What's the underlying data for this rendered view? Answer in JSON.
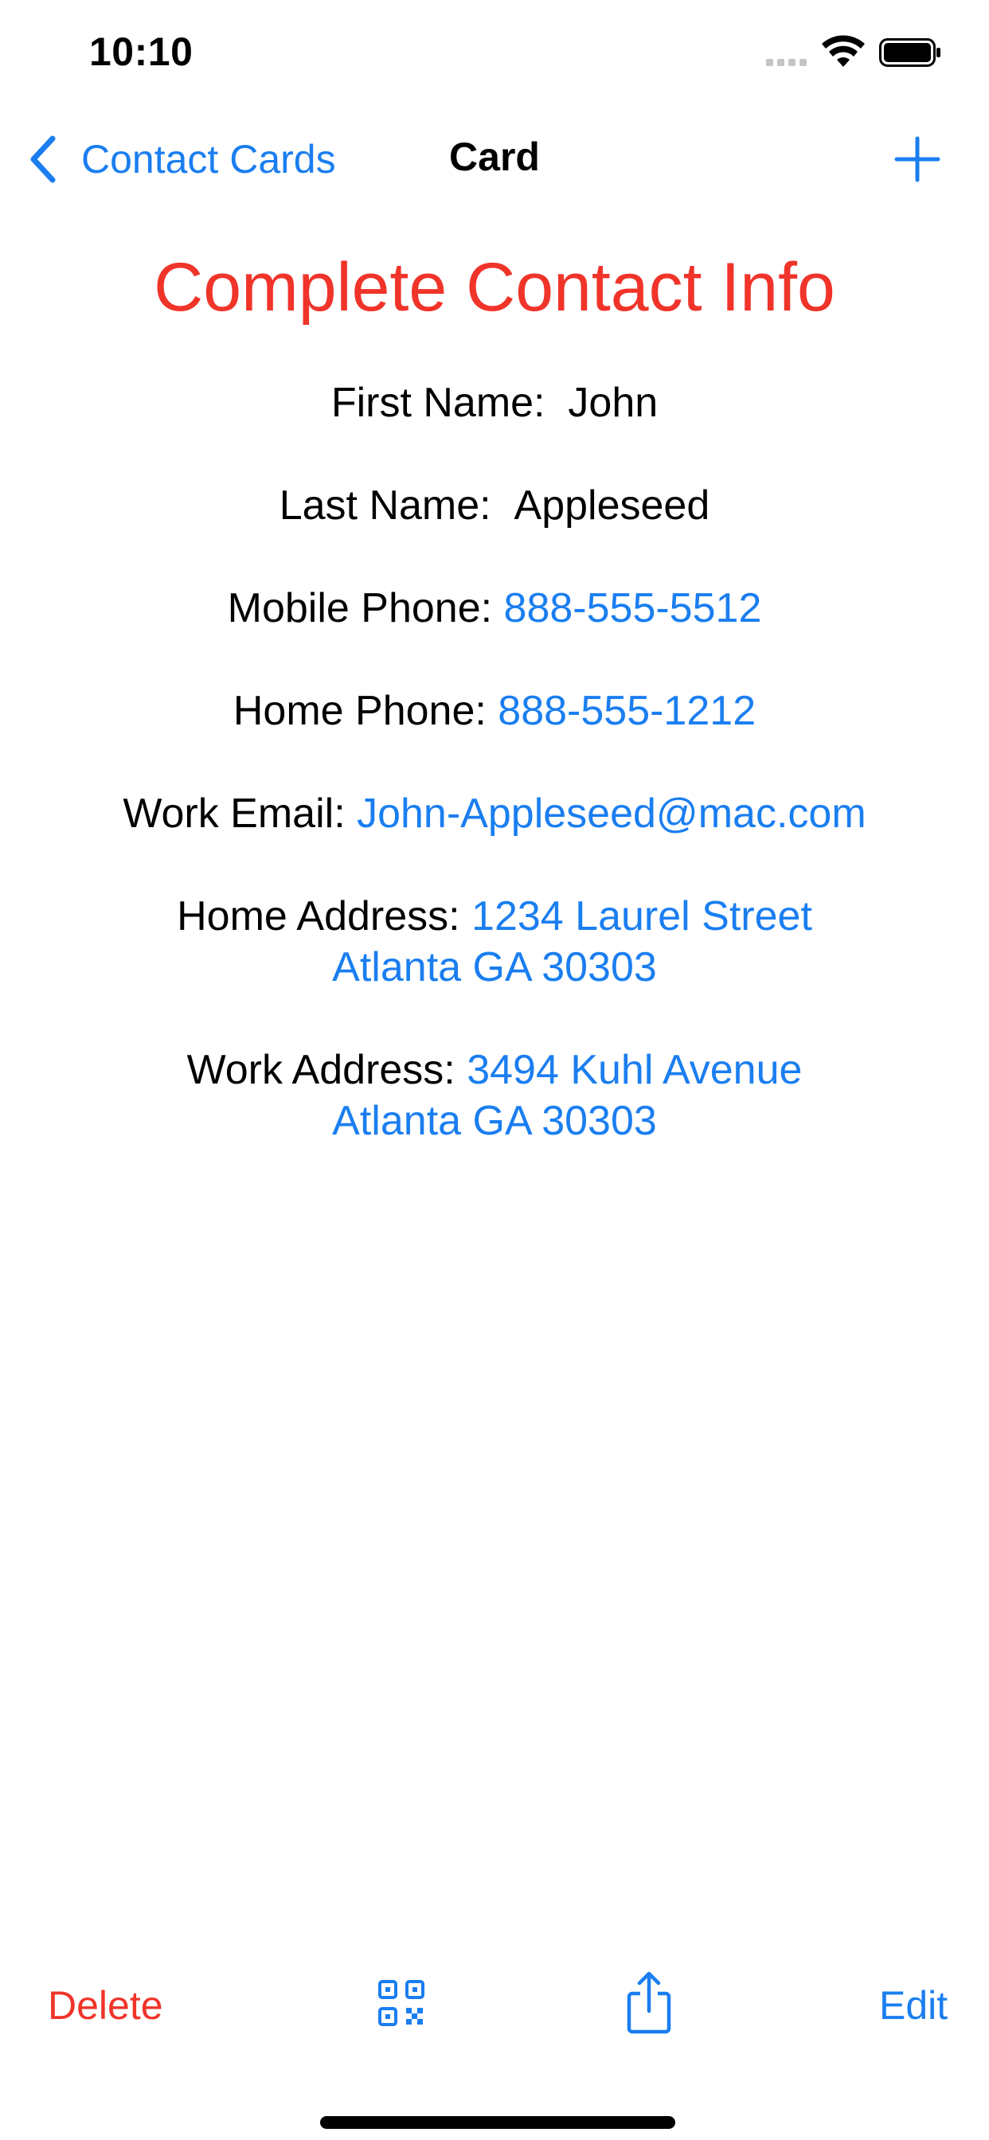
{
  "status_bar": {
    "time": "10:10"
  },
  "nav": {
    "back_label": "Contact Cards",
    "title": "Card"
  },
  "heading": "Complete Contact Info",
  "contact": {
    "first_name_label": "First Name:",
    "first_name": "John",
    "last_name_label": "Last Name:",
    "last_name": "Appleseed",
    "mobile_label": "Mobile Phone:",
    "mobile": "888-555-5512",
    "home_phone_label": "Home Phone:",
    "home_phone": "888-555-1212",
    "work_email_label": "Work Email:",
    "work_email": "John-Appleseed@mac.com",
    "home_address_label": "Home Address:",
    "home_address_line1": "1234 Laurel Street",
    "home_address_line2": "Atlanta GA 30303",
    "work_address_label": "Work Address:",
    "work_address_line1": "3494 Kuhl Avenue",
    "work_address_line2": "Atlanta GA 30303"
  },
  "toolbar": {
    "delete_label": "Delete",
    "edit_label": "Edit",
    "qr_icon": "qr-code-icon",
    "share_icon": "share-icon"
  },
  "colors": {
    "accent": "#1a7ef0",
    "destructive": "#f0342a"
  }
}
